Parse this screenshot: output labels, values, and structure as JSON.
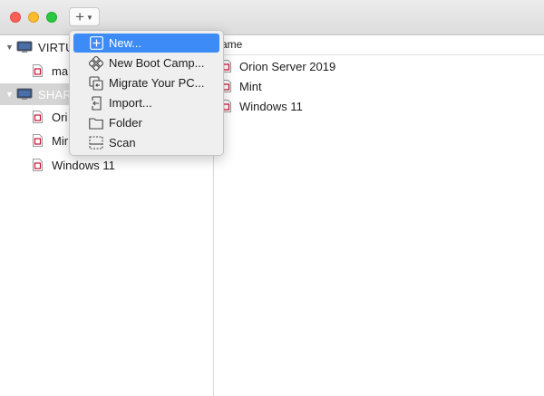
{
  "toolbar": {
    "add_symbol": "+",
    "add_chevron": "⌄"
  },
  "sidebar": {
    "groups": [
      {
        "label": "VIRTU",
        "items": [
          {
            "label": "ma"
          }
        ]
      },
      {
        "label": "SHAR",
        "items": [
          {
            "label": "Ori"
          },
          {
            "label": "Mir"
          },
          {
            "label": "Windows 11"
          }
        ]
      }
    ]
  },
  "main": {
    "column_header": "ame",
    "rows": [
      {
        "label": "Orion Server 2019"
      },
      {
        "label": "Mint"
      },
      {
        "label": "Windows 11"
      }
    ]
  },
  "menu": {
    "items": [
      {
        "label": "New...",
        "icon": "plus-box-icon",
        "highlighted": true
      },
      {
        "label": "New Boot Camp...",
        "icon": "bootcamp-icon"
      },
      {
        "label": "Migrate Your PC...",
        "icon": "migrate-icon"
      },
      {
        "label": "Import...",
        "icon": "import-icon"
      },
      {
        "label": "Folder",
        "icon": "folder-icon"
      },
      {
        "label": "Scan",
        "icon": "scan-icon"
      }
    ]
  },
  "colors": {
    "highlight": "#3d8bf7",
    "doc_accent": "#c8102e"
  }
}
